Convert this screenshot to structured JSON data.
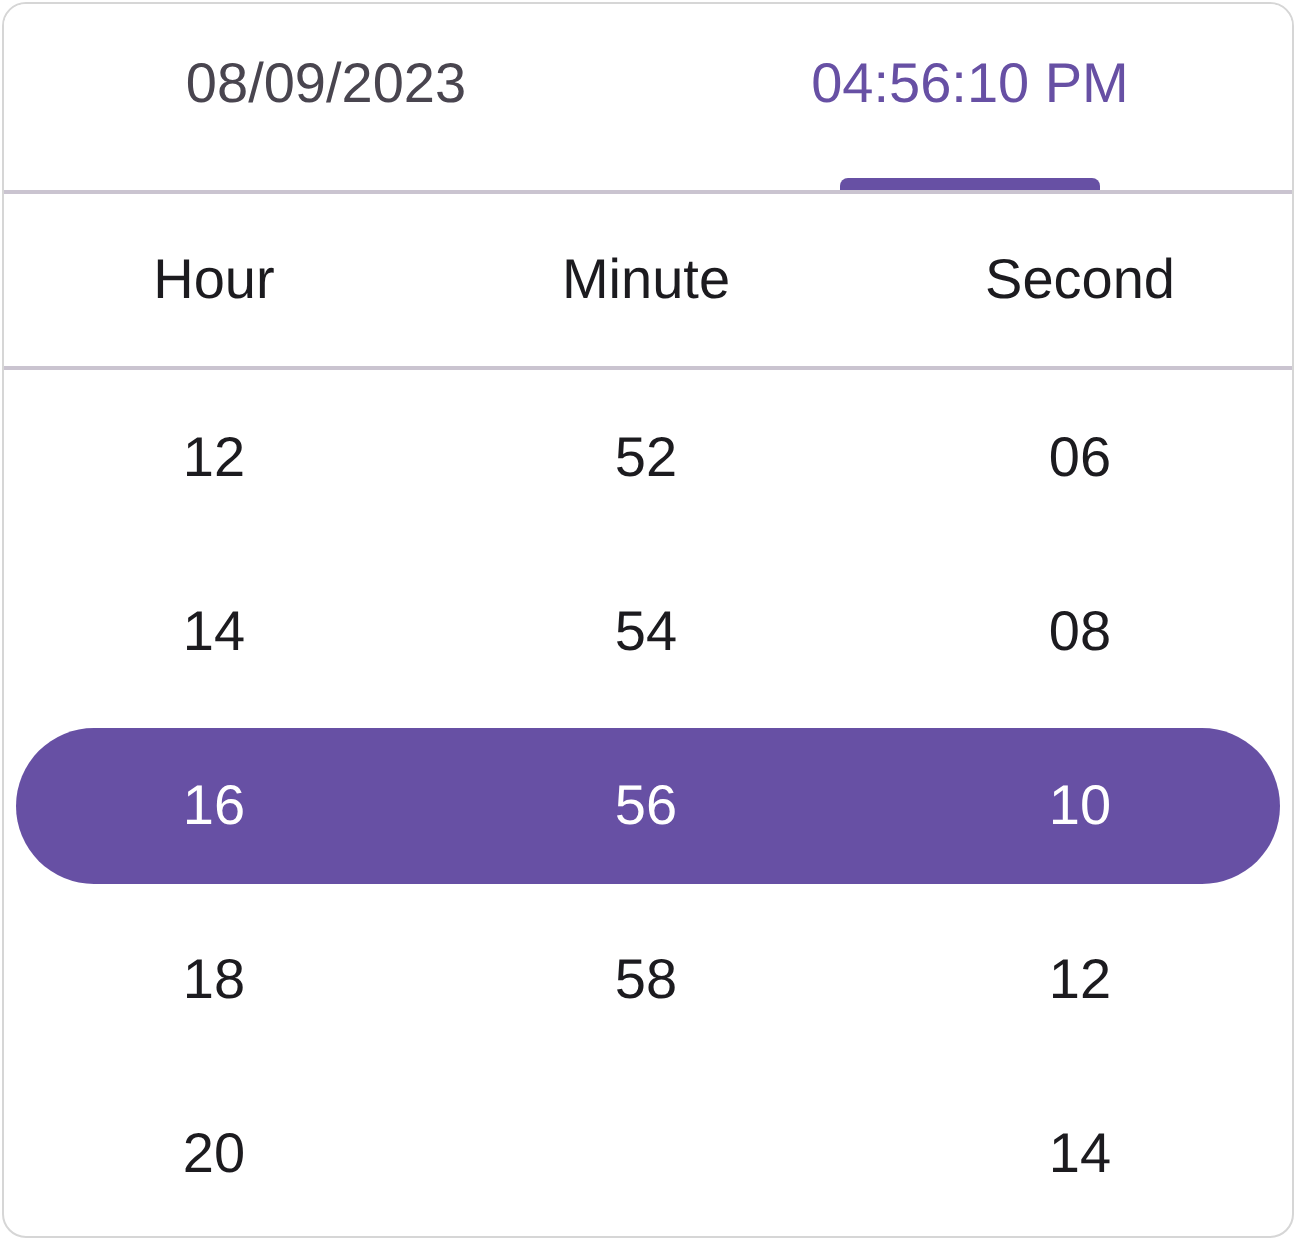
{
  "tabs": [
    {
      "label": "08/09/2023",
      "selected": false
    },
    {
      "label": "04:56:10 PM",
      "selected": true
    }
  ],
  "columns": [
    "Hour",
    "Minute",
    "Second"
  ],
  "rows": [
    {
      "cells": [
        "12",
        "52",
        "06"
      ],
      "selected": false
    },
    {
      "cells": [
        "14",
        "54",
        "08"
      ],
      "selected": false
    },
    {
      "cells": [
        "16",
        "56",
        "10"
      ],
      "selected": true
    },
    {
      "cells": [
        "18",
        "58",
        "12"
      ],
      "selected": false
    },
    {
      "cells": [
        "20",
        null,
        "14"
      ],
      "selected": false
    }
  ]
}
